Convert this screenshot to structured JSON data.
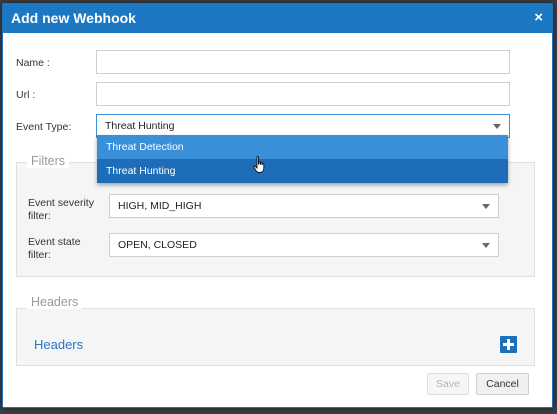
{
  "dialog": {
    "title": "Add new Webhook",
    "close_glyph": "×"
  },
  "form": {
    "name_label": "Name :",
    "name_value": "",
    "url_label": "Url :",
    "url_value": "",
    "event_type_label": "Event Type:",
    "event_type_value": "Threat Hunting",
    "event_type_options": [
      "Threat Detection",
      "Threat Hunting"
    ],
    "highlighted_option": "Threat Hunting"
  },
  "filters": {
    "legend": "Filters",
    "severity_label_line1": "Event severity",
    "severity_label_line2": "filter:",
    "severity_value": "HIGH, MID_HIGH",
    "state_label_line1": "Event state",
    "state_label_line2": "filter:",
    "state_value": "OPEN, CLOSED"
  },
  "headers": {
    "legend": "Headers",
    "label": "Headers",
    "add_icon": "plus-icon"
  },
  "footer": {
    "save_label": "Save",
    "cancel_label": "Cancel"
  },
  "colors": {
    "titlebar": "#1d78c4",
    "dropdown_highlight": "#1e6db9",
    "dropdown_item": "#3a8fd9",
    "headers_text": "#2a76bf"
  }
}
